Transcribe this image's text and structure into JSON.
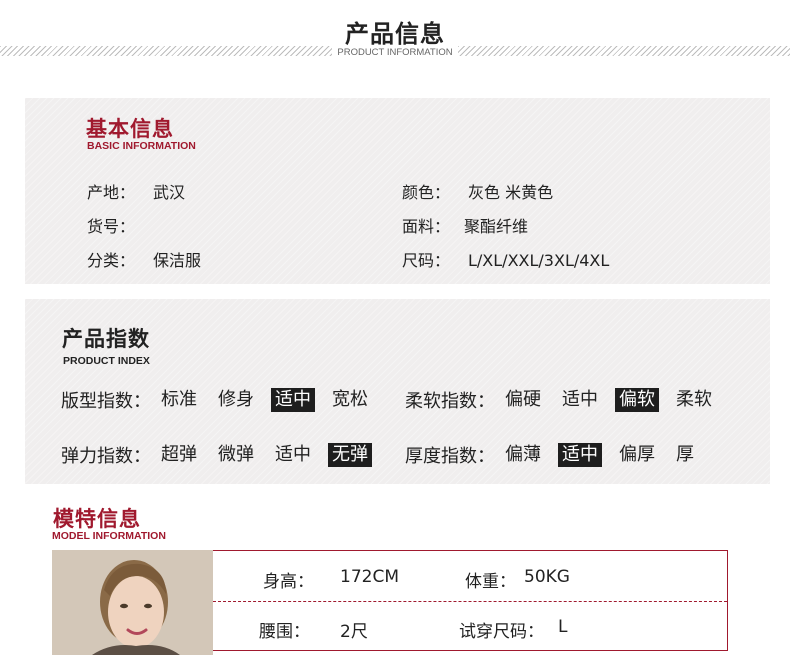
{
  "header": {
    "title": "产品信息",
    "subtitle": "PRODUCT INFORMATION"
  },
  "basic": {
    "title": "基本信息",
    "subtitle": "BASIC INFORMATION",
    "left": [
      {
        "label": "产地：",
        "value": "武汉"
      },
      {
        "label": "货号：",
        "value": ""
      },
      {
        "label": "分类：",
        "value": "保洁服"
      }
    ],
    "right": [
      {
        "label": "颜色：",
        "value": "灰色 米黄色"
      },
      {
        "label": "面料：",
        "value": "聚酯纤维"
      },
      {
        "label": "尺码：",
        "value": "L/XL/XXL/3XL/4XL"
      }
    ]
  },
  "index": {
    "title": "产品指数",
    "subtitle": "PRODUCT INDEX",
    "rows": [
      {
        "label": "版型指数：",
        "options": [
          "标准",
          "修身",
          "适中",
          "宽松"
        ],
        "selected": 2
      },
      {
        "label": "柔软指数：",
        "options": [
          "偏硬",
          "适中",
          "偏软",
          "柔软"
        ],
        "selected": 2
      },
      {
        "label": "弹力指数：",
        "options": [
          "超弹",
          "微弹",
          "适中",
          "无弹"
        ],
        "selected": 3
      },
      {
        "label": "厚度指数：",
        "options": [
          "偏薄",
          "适中",
          "偏厚",
          "厚"
        ],
        "selected": 1
      }
    ]
  },
  "model": {
    "title": "模特信息",
    "subtitle": "MODEL INFORMATION",
    "height_label": "身高：",
    "height": "172CM",
    "weight_label": "体重：",
    "weight": "50KG",
    "waist_label": "腰围：",
    "waist": "2尺",
    "size_label": "试穿尺码：",
    "size": "L"
  },
  "colors": {
    "accent": "#a0192e",
    "panel_bg": "#f0eeee",
    "selected_bg": "#1e1e1e"
  }
}
